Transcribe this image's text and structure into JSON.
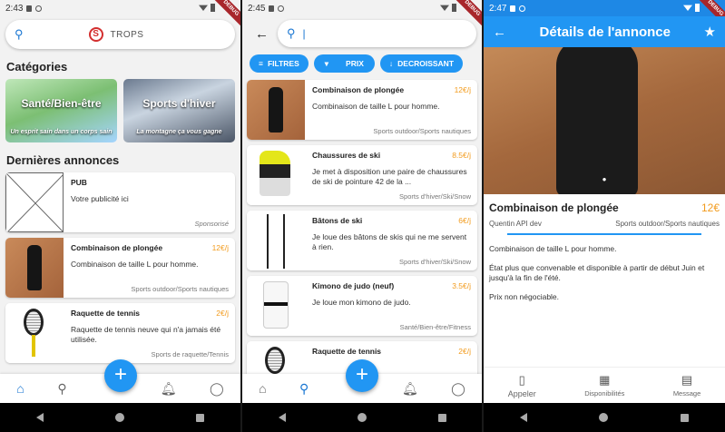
{
  "screen1": {
    "time": "2:43",
    "ribbon": "DEBUG",
    "brand": "TROPS",
    "categories_heading": "Catégories",
    "categories": [
      {
        "title": "Santé/Bien-être",
        "subtitle": "Un esprit sain dans un corps sain"
      },
      {
        "title": "Sports d'hiver",
        "subtitle": "La montagne ça vous gagne"
      }
    ],
    "latest_heading": "Dernières annonces",
    "ads": [
      {
        "title": "PUB",
        "price": "",
        "desc": "Votre publicité ici",
        "category": "Sponsorisé"
      },
      {
        "title": "Combinaison de plongée",
        "price": "12€/j",
        "desc": "Combinaison de taille L pour homme.",
        "category": "Sports outdoor/Sports nautiques"
      },
      {
        "title": "Raquette de tennis",
        "price": "2€/j",
        "desc": "Raquette de tennis neuve qui n'a jamais été utilisée.",
        "category": "Sports de raquette/Tennis"
      }
    ]
  },
  "screen2": {
    "time": "2:45",
    "ribbon": "DEBUG",
    "search_value": "|",
    "filters": [
      {
        "label": "FILTRES",
        "icon": "filter-icon"
      },
      {
        "label": "PRIX",
        "icon": "dropdown-icon"
      },
      {
        "label": "DECROISSANT",
        "icon": "arrow-down-icon"
      }
    ],
    "results": [
      {
        "title": "Combinaison de plongée",
        "price": "12€/j",
        "desc": "Combinaison de taille L pour homme.",
        "category": "Sports outdoor/Sports nautiques"
      },
      {
        "title": "Chaussures de ski",
        "price": "8.5€/j",
        "desc": "Je met à disposition une paire de chaussures de ski de pointure 42 de la ...",
        "category": "Sports d'hiver/Ski/Snow"
      },
      {
        "title": "Bâtons de ski",
        "price": "6€/j",
        "desc": "Je loue des bâtons de skis qui ne me servent à rien.",
        "category": "Sports d'hiver/Ski/Snow"
      },
      {
        "title": "Kimono de judo (neuf)",
        "price": "3.5€/j",
        "desc": "Je loue mon kimono de judo.",
        "category": "Santé/Bien-être/Fitness"
      },
      {
        "title": "Raquette de tennis",
        "price": "2€/j",
        "desc": "",
        "category": ""
      }
    ]
  },
  "screen3": {
    "time": "2:47",
    "ribbon": "DEBUG",
    "header_title": "Détails de l'annonce",
    "ad_title": "Combinaison de plongée",
    "ad_price": "12€",
    "owner": "Quentin API dev",
    "category": "Sports outdoor/Sports nautiques",
    "desc1": "Combinaison de taille L pour homme.",
    "desc2": "État plus que convenable et disponible à partir de début Juin et jusqu'à la fin de l'été.",
    "desc3": "Prix non négociable.",
    "actions": [
      {
        "label": "Appeler",
        "icon": "phone-icon"
      },
      {
        "label": "Disponibilités",
        "icon": "calendar-icon"
      },
      {
        "label": "Message",
        "icon": "message-icon"
      }
    ]
  },
  "colors": {
    "accent": "#2196f3",
    "price": "#f29b1d",
    "ribbon": "#a8262b"
  }
}
